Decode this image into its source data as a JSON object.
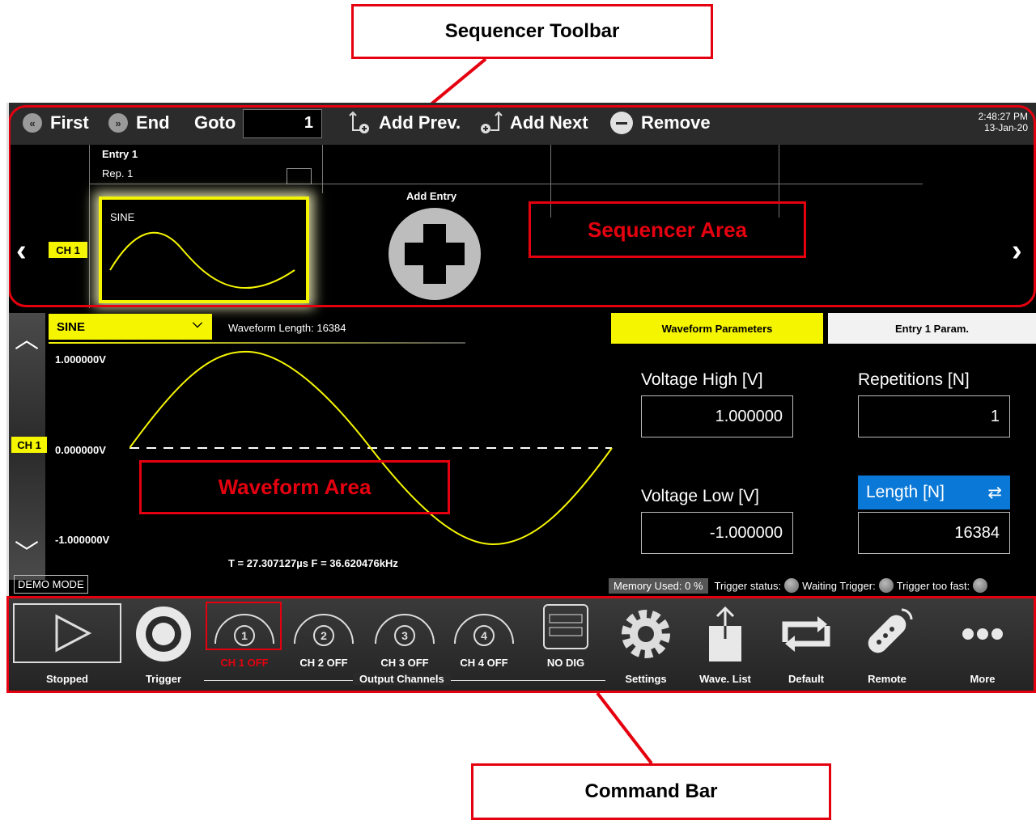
{
  "callouts": {
    "toolbar": "Sequencer Toolbar",
    "command": "Command Bar",
    "sequencer_area": "Sequencer Area",
    "waveform_area": "Waveform Area"
  },
  "toolbar": {
    "first": "First",
    "end": "End",
    "goto": "Goto",
    "goto_value": "1",
    "add_prev": "Add Prev.",
    "add_next": "Add Next",
    "remove": "Remove",
    "time": "2:48:27 PM",
    "date": "13-Jan-20"
  },
  "sequencer": {
    "entry_label": "Entry  1",
    "rep_label": "Rep.  1",
    "channel": "CH 1",
    "waveform_name": "SINE",
    "add_entry": "Add Entry"
  },
  "waveform": {
    "type": "SINE",
    "length_text": "Waveform Length:  16384",
    "v_high": "1.000000V",
    "v_zero": "0.000000V",
    "v_low": "-1.000000V",
    "channel": "CH 1",
    "period_freq": "T =  27.307127µs   F =  36.620476kHz"
  },
  "params": {
    "tab_waveform": "Waveform Parameters",
    "tab_entry": "Entry  1  Param.",
    "voltage_high_label": "Voltage High [V]",
    "voltage_high_value": "1.000000",
    "repetitions_label": "Repetitions [N]",
    "repetitions_value": "1",
    "voltage_low_label": "Voltage Low [V]",
    "voltage_low_value": "-1.000000",
    "length_label": "Length [N]",
    "length_value": "16384"
  },
  "status": {
    "demo": "DEMO MODE",
    "memory": "Memory Used:   0 %",
    "trigger_status": "Trigger status:",
    "waiting": "Waiting Trigger:",
    "too_fast": "Trigger too fast:"
  },
  "command_bar": {
    "stopped": "Stopped",
    "trigger": "Trigger",
    "ch1": "CH 1 OFF",
    "ch2": "CH 2 OFF",
    "ch3": "CH 3 OFF",
    "ch4": "CH 4 OFF",
    "ch1_num": "1",
    "ch2_num": "2",
    "ch3_num": "3",
    "ch4_num": "4",
    "no_dig": "NO DIG",
    "output_channels": "Output Channels",
    "settings": "Settings",
    "wave_list": "Wave. List",
    "default": "Default",
    "remote": "Remote",
    "more": "More"
  },
  "colors": {
    "accent_red": "#e5000f",
    "waveform_yellow": "#f5f500",
    "length_blue": "#0a78d7"
  }
}
